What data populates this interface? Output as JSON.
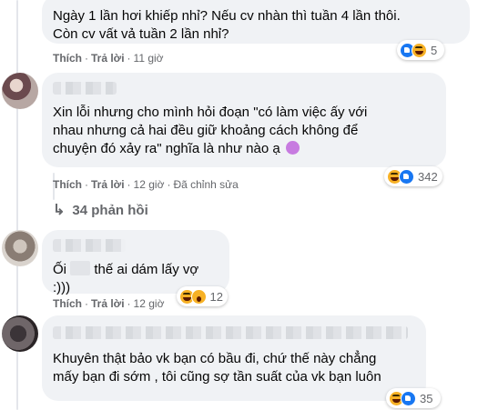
{
  "comments": [
    {
      "text": "Ngày 1 lần hơi khiếp nhỉ? Nếu cv nhàn thì tuần 4 lần thôi.\nCòn cv vất vả tuần 2 lần nhỉ?",
      "actions": {
        "like": "Thích",
        "reply": "Trả lời",
        "time": "11 giờ"
      },
      "reaction_count": "5",
      "reaction_icons": [
        "like-icon",
        "haha-icon"
      ]
    },
    {
      "text": "Xin lỗi nhưng cho mình hỏi đoạn \"có làm việc ấy với\nnhau nhưng cả hai đều giữ khoảng cách không để\nchuyện đó xảy ra\" nghĩa là như nào ạ",
      "trailing_emoji": "flushed-face-icon",
      "actions": {
        "like": "Thích",
        "reply": "Trả lời",
        "time": "12 giờ",
        "edited": "Đã chỉnh sửa"
      },
      "reaction_count": "342",
      "reaction_icons": [
        "haha-icon",
        "like-icon"
      ],
      "replies_label": "34 phản hồi"
    },
    {
      "text_before": "Ối",
      "text_after": "thế ai dám lấy vợ :)))",
      "actions": {
        "like": "Thích",
        "reply": "Trả lời",
        "time": "12 giờ"
      },
      "reaction_count": "12",
      "reaction_icons": [
        "haha-icon",
        "wow-icon"
      ]
    },
    {
      "text": "Khuyên thật bảo vk bạn có bầu đi, chứ thế này chẳng\nmấy bạn đi sớm , tôi cũng sợ tần suất của vk bạn luôn",
      "reaction_count": "35",
      "reaction_icons": [
        "haha-icon",
        "like-icon"
      ]
    }
  ],
  "colors": {
    "bubble": "#f0f2f5",
    "meta_text": "#65676b",
    "like_blue": "#1877f2",
    "haha_yellow": "#f7b125"
  }
}
